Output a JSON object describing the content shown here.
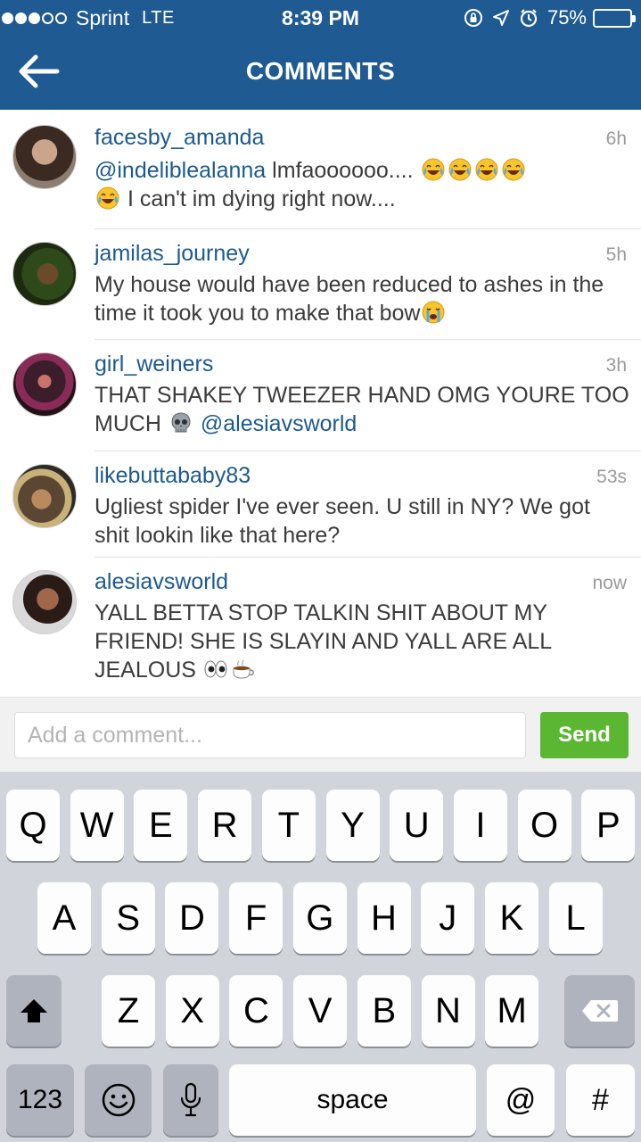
{
  "status_bar": {
    "carrier": "Sprint",
    "network": "LTE",
    "time": "8:39 PM",
    "battery": "75%",
    "battery_level": 0.75,
    "icons": [
      "signal-dots-icon",
      "rotation-lock-icon",
      "location-arrow-icon",
      "alarm-icon",
      "battery-icon"
    ]
  },
  "nav": {
    "title": "COMMENTS",
    "back_icon": "back-arrow-icon"
  },
  "comments": [
    {
      "username": "facesby_amanda",
      "time": "6h",
      "mention": "@indeliblealanna",
      "text_a": " lmfaoooooo.... ",
      "text_b": " I can't im dying right now....",
      "emoji": [
        "crying-laughing-emoji",
        "crying-laughing-emoji",
        "crying-laughing-emoji",
        "crying-laughing-emoji",
        "crying-laughing-emoji"
      ]
    },
    {
      "username": "jamilas_journey",
      "time": "5h",
      "text_a": "My house would have been reduced to ashes in the time it took you to make that bow",
      "emoji": [
        "loudly-crying-emoji"
      ]
    },
    {
      "username": "girl_weiners",
      "time": "3h",
      "text_a": "THAT SHAKEY TWEEZER HAND OMG YOURE TOO MUCH ",
      "mention": "@alesiavsworld",
      "emoji": [
        "skull-emoji"
      ]
    },
    {
      "username": "likebuttababy83",
      "time": "53s",
      "text_a": "Ugliest spider I've ever seen. U still in NY? We got shit lookin like that here?"
    },
    {
      "username": "alesiavsworld",
      "time": "now",
      "text_a": "YALL BETTA STOP TALKIN SHIT ABOUT MY FRIEND! SHE IS SLAYIN AND YALL ARE ALL JEALOUS ",
      "emoji": [
        "eyes-emoji",
        "coffee-emoji"
      ]
    }
  ],
  "input": {
    "placeholder": "Add a comment...",
    "value": "",
    "send_label": "Send"
  },
  "keyboard": {
    "row1": [
      "Q",
      "W",
      "E",
      "R",
      "T",
      "Y",
      "U",
      "I",
      "O",
      "P"
    ],
    "row2": [
      "A",
      "S",
      "D",
      "F",
      "G",
      "H",
      "J",
      "K",
      "L"
    ],
    "row3": [
      "Z",
      "X",
      "C",
      "V",
      "B",
      "N",
      "M"
    ],
    "numbers_label": "123",
    "space_label": "space",
    "at_label": "@",
    "hash_label": "#",
    "icons": [
      "shift-icon",
      "delete-icon",
      "emoji-keyboard-icon",
      "microphone-icon"
    ]
  },
  "colors": {
    "header": "#1f5a92",
    "username": "#1c5a8e",
    "send": "#5bb632",
    "keyboard_bg": "#d1d5db"
  }
}
